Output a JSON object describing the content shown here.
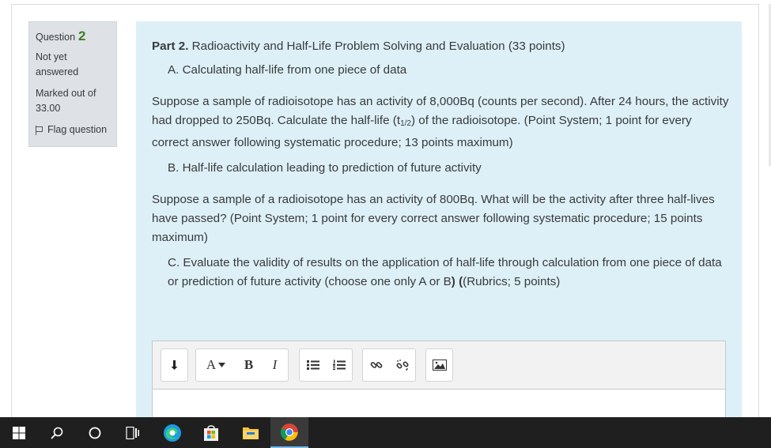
{
  "question_info": {
    "label": "Question",
    "number": "2",
    "state": "Not yet answered",
    "grade": "Marked out of 33.00",
    "flag_label": "Flag question"
  },
  "question": {
    "part_bold": "Part 2.",
    "part_title": "Radioactivity and Half-Life Problem Solving and Evaluation (33 points)",
    "item_a": "A. Calculating half-life from one piece of data",
    "para_a_1": "Suppose a sample of radioisotope has an activity of 8,000Bq (counts per second). After 24 hours, the activity had dropped to 250Bq. Calculate the half-life (t",
    "para_a_sub": "1/2",
    "para_a_2": ") of the radioisotope. (Point System; 1 point for every correct answer following systematic procedure; 13 points maximum)",
    "item_b": "B. Half-life calculation leading to prediction of future activity",
    "para_b": "Suppose a sample of a radioisotope has an activity of 800Bq. What will be the activity after three half-lives have passed? (Point System; 1 point for every correct answer following systematic procedure; 15 points maximum)",
    "item_c_1": "C. Evaluate the validity of results on the application of half-life through calculation from one piece of data or prediction of future activity (choose one only A or B",
    "item_c_bold": ") (",
    "item_c_2": "(Rubrics; 5 points)"
  },
  "editor": {
    "toolbar": {
      "toggle_icon": "arrow-down-icon",
      "font_color_label": "A",
      "bold_label": "B",
      "italic_label": "I",
      "unordered_list_icon": "unordered-list-icon",
      "ordered_list_icon": "ordered-list-icon",
      "link_icon": "link-icon",
      "unlink_icon": "unlink-icon",
      "image_icon": "image-icon"
    }
  },
  "taskbar": {
    "items": [
      "windows-start-icon",
      "search-icon",
      "cortana-icon",
      "task-view-icon",
      "edge-icon",
      "store-icon",
      "file-explorer-icon",
      "chrome-icon"
    ],
    "active_item": "chrome-icon"
  }
}
